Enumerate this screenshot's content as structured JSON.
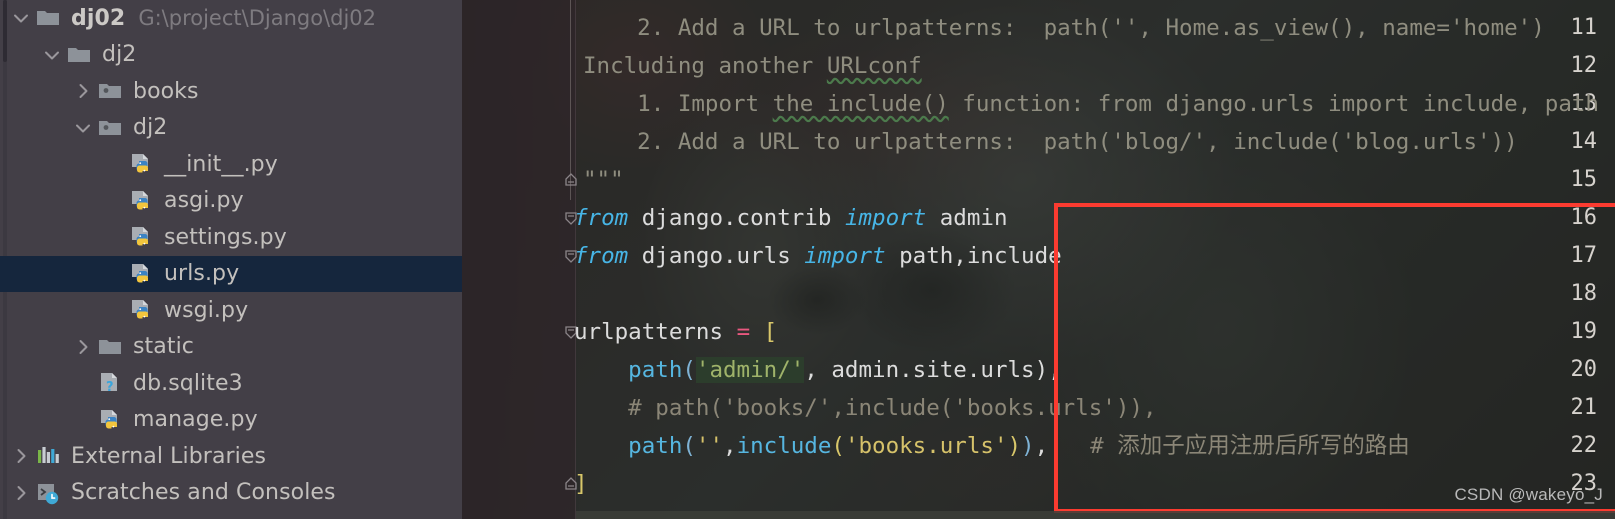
{
  "ide": {
    "name": "PyCharm Project View",
    "watermark": "CSDN @wakeyo_J",
    "colors": {
      "sidebar_bg": "#433f47",
      "selection_navy": "#15263d",
      "annotation_red": "#fb3b30",
      "keyword_cyan": "#47b5e6",
      "string_green": "#9fb36a",
      "string_yellow": "#d6c26a",
      "comment_gray": "#8b8677",
      "operator_pink": "#e8587f",
      "docstring_gray": "#8f8d7f"
    }
  },
  "sidebar": {
    "items": [
      {
        "label": "dj02",
        "path": "G:\\project\\Django\\dj02",
        "icon": "folder-icon",
        "twisty": "chevron-down",
        "indent": 0,
        "bold": true,
        "selected": false
      },
      {
        "label": "dj2",
        "path": "",
        "icon": "folder-icon",
        "twisty": "chevron-down",
        "indent": 1,
        "bold": false,
        "selected": false
      },
      {
        "label": "books",
        "path": "",
        "icon": "module-folder-icon",
        "twisty": "chevron-right",
        "indent": 2,
        "bold": false,
        "selected": false
      },
      {
        "label": "dj2",
        "path": "",
        "icon": "module-folder-icon",
        "twisty": "chevron-down",
        "indent": 2,
        "bold": false,
        "selected": false
      },
      {
        "label": "__init__.py",
        "path": "",
        "icon": "python-file-icon",
        "twisty": "none",
        "indent": 3,
        "bold": false,
        "selected": false
      },
      {
        "label": "asgi.py",
        "path": "",
        "icon": "python-file-icon",
        "twisty": "none",
        "indent": 3,
        "bold": false,
        "selected": false
      },
      {
        "label": "settings.py",
        "path": "",
        "icon": "python-file-icon",
        "twisty": "none",
        "indent": 3,
        "bold": false,
        "selected": false
      },
      {
        "label": "urls.py",
        "path": "",
        "icon": "python-file-icon",
        "twisty": "none",
        "indent": 3,
        "bold": false,
        "selected": true
      },
      {
        "label": "wsgi.py",
        "path": "",
        "icon": "python-file-icon",
        "twisty": "none",
        "indent": 3,
        "bold": false,
        "selected": false
      },
      {
        "label": "static",
        "path": "",
        "icon": "folder-icon",
        "twisty": "chevron-right",
        "indent": 2,
        "bold": false,
        "selected": false
      },
      {
        "label": "db.sqlite3",
        "path": "",
        "icon": "unknown-file-icon",
        "twisty": "none",
        "indent": 2,
        "bold": false,
        "selected": false
      },
      {
        "label": "manage.py",
        "path": "",
        "icon": "python-file-icon",
        "twisty": "none",
        "indent": 2,
        "bold": false,
        "selected": false
      },
      {
        "label": "External Libraries",
        "path": "",
        "icon": "libraries-icon",
        "twisty": "chevron-right",
        "indent": 0,
        "bold": false,
        "selected": false
      },
      {
        "label": "Scratches and Consoles",
        "path": "",
        "icon": "scratches-icon",
        "twisty": "chevron-right",
        "indent": 0,
        "bold": false,
        "selected": false
      }
    ]
  },
  "editor": {
    "file": "urls.py",
    "first_visible_line": 11,
    "line_numbers": [
      "11",
      "12",
      "13",
      "14",
      "15",
      "16",
      "17",
      "18",
      "19",
      "20",
      "21",
      "22",
      "23"
    ],
    "lines": {
      "l11": "    2. Add a URL to urlpatterns:  path('', Home.as_view(), name='home')",
      "l12a": "Including another ",
      "l12b": "URLconf",
      "l13a": "    1. Import ",
      "l13b": "the include()",
      "l13c": " function: from django.urls import include, path",
      "l14": "    2. Add a URL to urlpatterns:  path('blog/', include('blog.urls'))",
      "l15": "\"\"\"",
      "l16_kw1": "from",
      "l16_mod": " django.contrib ",
      "l16_kw2": "import",
      "l16_name": " admin",
      "l17_kw1": "from",
      "l17_mod": " django.urls ",
      "l17_kw2": "import",
      "l17_name": " path,include",
      "l18": "",
      "l19_var": "urlpatterns ",
      "l19_op": "=",
      "l19_br": " [",
      "l20_fn": "    path",
      "l20_p1": "(",
      "l20_q1": "'",
      "l20_str": "admin/",
      "l20_q2": "'",
      "l20_rest": ", admin.site.urls)",
      "l20_end": ",",
      "l21": "    # path('books/',include('books.urls')),",
      "l22_fn": "    path",
      "l22_p1": "(",
      "l22_str1": "''",
      "l22_comma": ",",
      "l22_fn2": "include",
      "l22_p2": "(",
      "l22_str2": "'books.urls'",
      "l22_p3": ")",
      "l22_p4": ")",
      "l22_end": ",",
      "l22_cmt": "# 添加子应用注册后所写的路由",
      "l23": "]"
    }
  }
}
